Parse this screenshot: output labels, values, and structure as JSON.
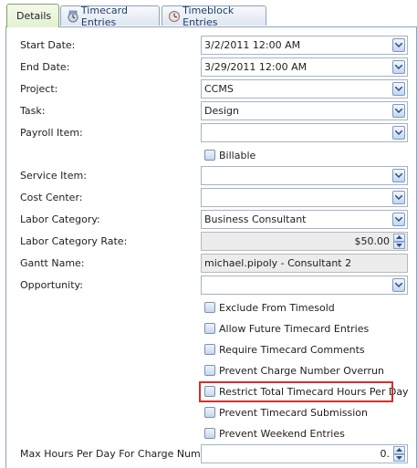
{
  "tabs": [
    {
      "label": "Details",
      "icon": "none"
    },
    {
      "label": "Timecard Entries",
      "icon": "timecard-icon"
    },
    {
      "label": "Timeblock Entries",
      "icon": "timeblock-icon"
    }
  ],
  "form": {
    "start_date": {
      "label": "Start Date:",
      "value": "3/2/2011 12:00 AM"
    },
    "end_date": {
      "label": "End Date:",
      "value": "3/29/2011 12:00 AM"
    },
    "project": {
      "label": "Project:",
      "value": "CCMS"
    },
    "task": {
      "label": "Task:",
      "value": "Design"
    },
    "payroll_item": {
      "label": "Payroll Item:",
      "value": ""
    },
    "billable": {
      "label": "Billable"
    },
    "service_item": {
      "label": "Service Item:",
      "value": ""
    },
    "cost_center": {
      "label": "Cost Center:",
      "value": ""
    },
    "labor_category": {
      "label": "Labor Category:",
      "value": "Business Consultant"
    },
    "labor_category_rate": {
      "label": "Labor Category Rate:",
      "value": "$50.00"
    },
    "gantt_name": {
      "label": "Gantt Name:",
      "value": "michael.pipoly - Consultant 2"
    },
    "opportunity": {
      "label": "Opportunity:",
      "value": ""
    },
    "checkboxes": [
      "Exclude From Timesold",
      "Allow Future Timecard Entries",
      "Require Timecard Comments",
      "Prevent Charge Number Overrun",
      "Restrict Total Timecard Hours Per Day",
      "Prevent Timecard Submission",
      "Prevent Weekend Entries"
    ],
    "max_hours": {
      "label": "Max Hours Per Day For Charge Number:",
      "value": "0."
    }
  },
  "colors": {
    "highlight": "#d42e2e",
    "active_tab": "#e3f1d3",
    "border": "#8ea2c1"
  }
}
